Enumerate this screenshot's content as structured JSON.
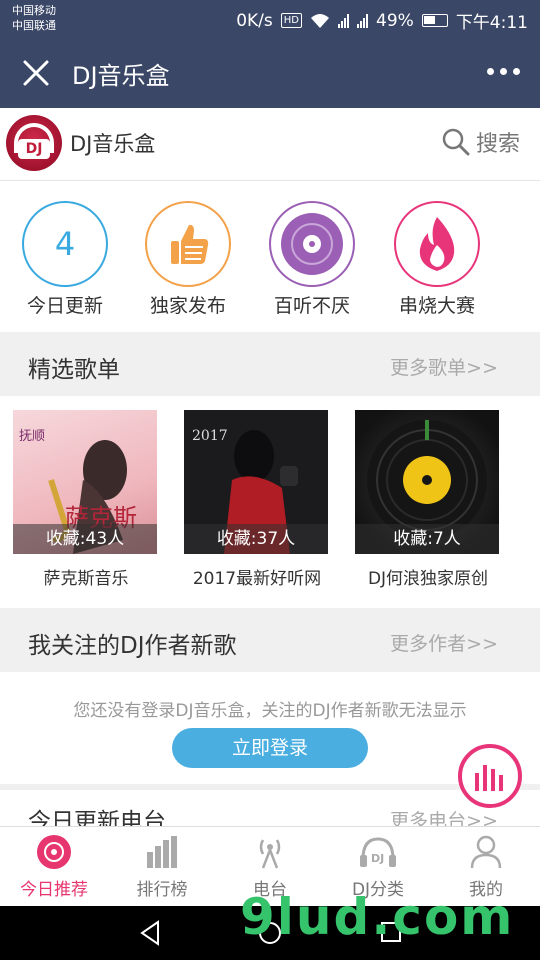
{
  "status": {
    "carrier1": "中国移动",
    "carrier2": "中国联通",
    "speed": "0K/s",
    "hd": "HD",
    "battery": "49%",
    "time": "下午4:11"
  },
  "nav": {
    "title": "DJ音乐盒"
  },
  "header": {
    "app_name": "DJ音乐盒",
    "logo_text": "DJ",
    "search_label": "搜索"
  },
  "quick": {
    "items": [
      {
        "number": "4",
        "label": "今日更新",
        "color": "#39a9e0",
        "icon": "calendar-number-icon"
      },
      {
        "label": "独家发布",
        "color": "#f3a24a",
        "icon": "thumbs-up-icon"
      },
      {
        "label": "百听不厌",
        "color": "#9b5fb5",
        "icon": "disc-icon"
      },
      {
        "label": "串烧大赛",
        "color": "#e8357a",
        "icon": "flame-icon"
      }
    ]
  },
  "playlists": {
    "title": "精选歌单",
    "more": "更多歌单>>",
    "items": [
      {
        "fav": "收藏:43人",
        "name": "萨克斯音乐"
      },
      {
        "fav": "收藏:37人",
        "name": "2017最新好听网"
      },
      {
        "fav": "收藏:7人",
        "name": "DJ何浪独家原创"
      }
    ]
  },
  "authors": {
    "title": "我关注的DJ作者新歌",
    "more": "更多作者>>",
    "tip": "您还没有登录DJ音乐盒，关注的DJ作者新歌无法显示",
    "login_btn": "立即登录"
  },
  "stations": {
    "title": "今日更新电台",
    "more": "更多电台>>"
  },
  "tabs": [
    {
      "label": "今日推荐",
      "icon": "record-icon",
      "active": true
    },
    {
      "label": "排行榜",
      "icon": "bar-chart-icon",
      "active": false
    },
    {
      "label": "电台",
      "icon": "radio-tower-icon",
      "active": false
    },
    {
      "label": "DJ分类",
      "icon": "headphones-dj-icon",
      "active": false
    },
    {
      "label": "我的",
      "icon": "user-icon",
      "active": false
    }
  ],
  "watermark": "9lud.com",
  "colors": {
    "navbar": "#3a4766",
    "accent_pink": "#e6356f",
    "accent_blue": "#4aaee0"
  }
}
